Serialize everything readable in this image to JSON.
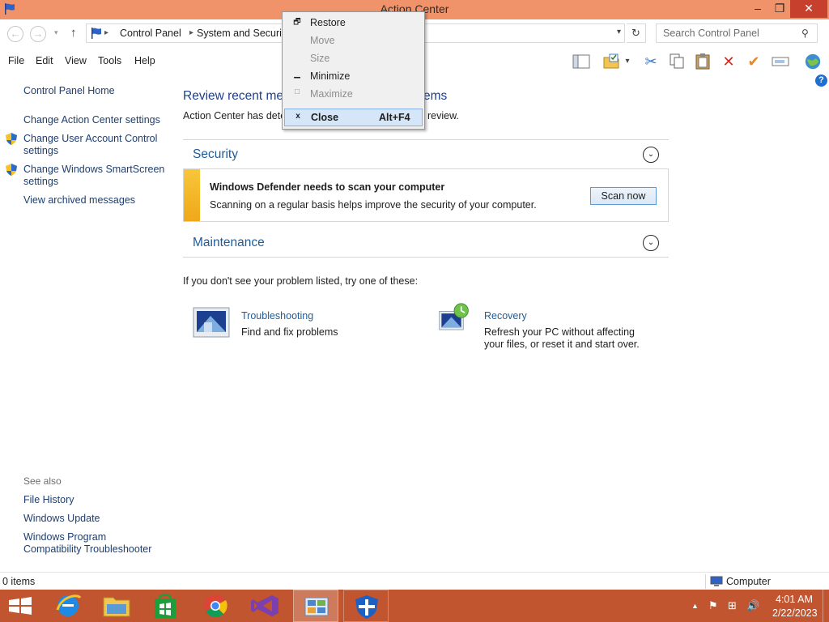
{
  "window": {
    "title": "Action Center",
    "controls": {
      "minimize": "–",
      "maximize": "❐",
      "close": "✕"
    }
  },
  "nav": {
    "back": "←",
    "forward": "→",
    "recent": "▾",
    "up": "↑",
    "breadcrumb": [
      "Control Panel",
      "System and Security"
    ],
    "breadcrumb_sep": "▸",
    "dropdown": "▾",
    "refresh": "↻",
    "search_placeholder": "Search Control Panel",
    "search_glyph": "⚲"
  },
  "menu": {
    "items": [
      "File",
      "Edit",
      "View",
      "Tools",
      "Help"
    ]
  },
  "toolbar": {
    "icons": [
      "layout-icon",
      "properties-folder-icon",
      "cut-icon",
      "copy-icon",
      "paste-icon",
      "delete-icon",
      "checkmark-icon",
      "rename-icon",
      "globe-icon"
    ],
    "glyphs": {
      "dropdown": "▾",
      "cut": "✂",
      "delete": "✕",
      "check": "✔",
      "help": "?"
    }
  },
  "left_pane": {
    "home": "Control Panel Home",
    "links": [
      "Change Action Center settings",
      "Change User Account Control settings",
      "Change Windows SmartScreen settings",
      "View archived messages"
    ],
    "see_also_label": "See also",
    "see_also": [
      "File History",
      "Windows Update",
      "Windows Program Compatibility Troubleshooter"
    ]
  },
  "main": {
    "title_left": "Review recent me",
    "title_right": "ems",
    "desc_left": "Action Center has dete",
    "desc_right": "review.",
    "security": {
      "heading": "Security",
      "alert_title": "Windows Defender needs to scan your computer",
      "alert_text": "Scanning on a regular basis helps improve the security of your computer.",
      "button": "Scan now"
    },
    "maintenance": {
      "heading": "Maintenance"
    },
    "chevron_glyph": "⌄",
    "suggest": "If you don't see your problem listed, try one of these:",
    "tools": [
      {
        "title": "Troubleshooting",
        "desc": "Find and fix problems"
      },
      {
        "title": "Recovery",
        "desc": "Refresh your PC without affecting your files, or reset it and start over."
      }
    ]
  },
  "context_menu": {
    "items": [
      {
        "label": "Restore",
        "icon": "restore-icon",
        "glyph": "🗗",
        "enabled": true,
        "accel": ""
      },
      {
        "label": "Move",
        "icon": "",
        "glyph": "",
        "enabled": false,
        "accel": ""
      },
      {
        "label": "Size",
        "icon": "",
        "glyph": "",
        "enabled": false,
        "accel": ""
      },
      {
        "label": "Minimize",
        "icon": "minimize-icon",
        "glyph": "▁",
        "enabled": true,
        "accel": ""
      },
      {
        "label": "Maximize",
        "icon": "maximize-icon",
        "glyph": "□",
        "enabled": false,
        "accel": ""
      },
      {
        "label": "Close",
        "icon": "close-icon",
        "glyph": "x",
        "enabled": true,
        "accel": "Alt+F4",
        "highlighted": true
      }
    ]
  },
  "status": {
    "items_count": "0 items",
    "location": "Computer"
  },
  "taskbar": {
    "apps": [
      "start-icon",
      "internet-explorer-icon",
      "file-explorer-icon",
      "store-icon",
      "chrome-icon",
      "visual-studio-icon",
      "control-panel-icon",
      "action-center-icon"
    ],
    "active_index": 6,
    "tray_glyphs": {
      "expand": "▲",
      "flag": "⚑",
      "network": "⊞",
      "volume": "🔊"
    },
    "clock_time": "4:01 AM",
    "clock_date": "2/22/2023"
  },
  "colors": {
    "titlebar": "#f0926a",
    "taskbar": "#c0552f",
    "link": "#1e5c9a",
    "alert_yellow": "#f8c63a",
    "close_button": "#c7402e"
  }
}
